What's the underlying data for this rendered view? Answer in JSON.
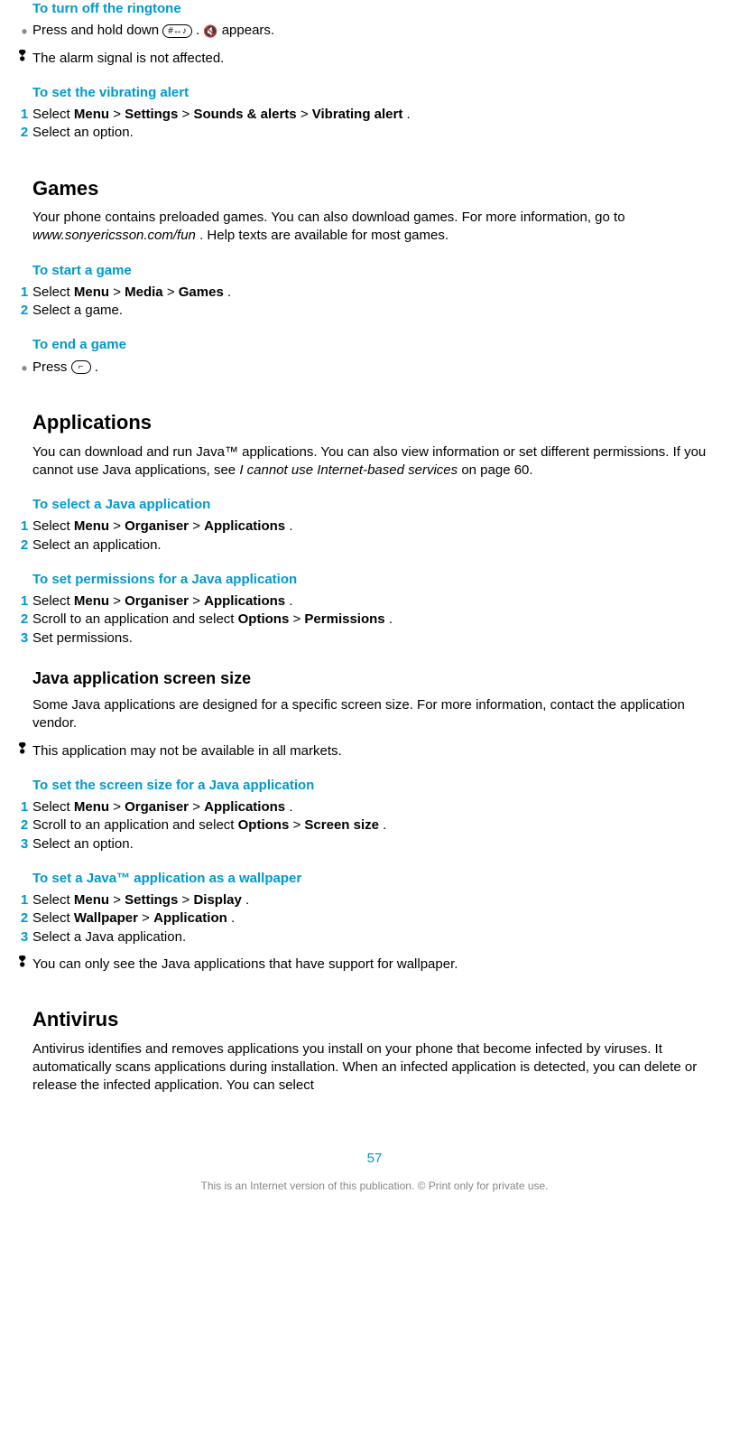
{
  "s1": {
    "title": "To turn off the ringtone",
    "step_text_a": "Press and hold down ",
    "step_text_b": ". ",
    "step_text_c": " appears.",
    "icon_label": "#↔♪",
    "note": "The alarm signal is not affected."
  },
  "s2": {
    "title": "To set the vibrating alert",
    "step1_a": "Select ",
    "step1_menu": "Menu",
    "step1_gt1": " > ",
    "step1_settings": "Settings",
    "step1_gt2": " > ",
    "step1_sounds": "Sounds & alerts",
    "step1_gt3": " > ",
    "step1_vibrating": "Vibrating alert",
    "step1_end": ".",
    "step2": "Select an option."
  },
  "games": {
    "heading": "Games",
    "para_a": "Your phone contains preloaded games. You can also download games. For more information, go to ",
    "para_url": "www.sonyericsson.com/fun",
    "para_b": ". Help texts are available for most games."
  },
  "s3": {
    "title": "To start a game",
    "step1_a": "Select ",
    "step1_menu": "Menu",
    "step1_gt1": " > ",
    "step1_media": "Media",
    "step1_gt2": " > ",
    "step1_games": "Games",
    "step1_end": ".",
    "step2": "Select a game."
  },
  "s4": {
    "title": "To end a game",
    "step_a": "Press ",
    "step_b": ".",
    "icon_label": "⌐"
  },
  "apps": {
    "heading": "Applications",
    "para_a": "You can download and run Java™ applications. You can also view information or set different permissions. If you cannot use Java applications, see ",
    "para_ref": "I cannot use Internet-based services",
    "para_b": " on page 60."
  },
  "s5": {
    "title": "To select a Java application",
    "step1_a": "Select ",
    "step1_menu": "Menu",
    "step1_gt1": " > ",
    "step1_org": "Organiser",
    "step1_gt2": " > ",
    "step1_apps": "Applications",
    "step1_end": ".",
    "step2": "Select an application."
  },
  "s6": {
    "title": "To set permissions for a Java application",
    "step1_a": "Select ",
    "step1_menu": "Menu",
    "step1_gt1": " > ",
    "step1_org": "Organiser",
    "step1_gt2": " > ",
    "step1_apps": "Applications",
    "step1_end": ".",
    "step2_a": "Scroll to an application and select ",
    "step2_options": "Options",
    "step2_gt": " > ",
    "step2_perm": "Permissions",
    "step2_end": ".",
    "step3": "Set permissions."
  },
  "jass": {
    "heading": "Java application screen size",
    "para": "Some Java applications are designed for a specific screen size. For more information, contact the application vendor.",
    "note": "This application may not be available in all markets."
  },
  "s7": {
    "title": "To set the screen size for a Java application",
    "step1_a": "Select ",
    "step1_menu": "Menu",
    "step1_gt1": " > ",
    "step1_org": "Organiser",
    "step1_gt2": " > ",
    "step1_apps": "Applications",
    "step1_end": ".",
    "step2_a": "Scroll to an application and select ",
    "step2_options": "Options",
    "step2_gt": " > ",
    "step2_screen": "Screen size",
    "step2_end": ".",
    "step3": "Select an option."
  },
  "s8": {
    "title": "To set a Java™ application as a wallpaper",
    "step1_a": "Select ",
    "step1_menu": "Menu",
    "step1_gt1": " > ",
    "step1_settings": "Settings",
    "step1_gt2": " > ",
    "step1_display": "Display",
    "step1_end": ".",
    "step2_a": "Select ",
    "step2_wallpaper": "Wallpaper",
    "step2_gt": " > ",
    "step2_app": "Application",
    "step2_end": ".",
    "step3": "Select a Java application.",
    "note": "You can only see the Java applications that have support for wallpaper."
  },
  "av": {
    "heading": "Antivirus",
    "para": "Antivirus identifies and removes applications you install on your phone that become infected by viruses. It automatically scans applications during installation. When an infected application is detected, you can delete or release the infected application. You can select"
  },
  "page_num": "57",
  "footer": "This is an Internet version of this publication. © Print only for private use.",
  "markers": {
    "m1": "1",
    "m2": "2",
    "m3": "3",
    "bullet": "•",
    "excl": "❢"
  }
}
